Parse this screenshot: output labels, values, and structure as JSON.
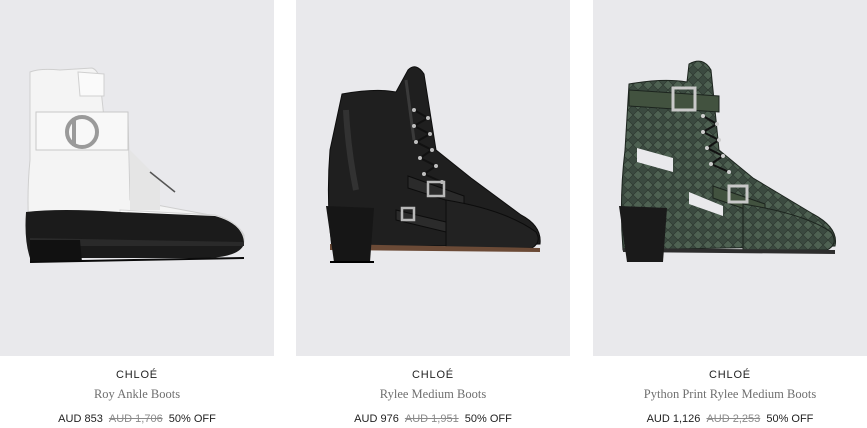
{
  "products": [
    {
      "brand": "CHLOÉ",
      "name": "Roy Ankle Boots",
      "price": "AUD 853",
      "original_price": "AUD 1,706",
      "discount": "50% OFF"
    },
    {
      "brand": "CHLOÉ",
      "name": "Rylee Medium Boots",
      "price": "AUD 976",
      "original_price": "AUD 1,951",
      "discount": "50% OFF"
    },
    {
      "brand": "CHLOÉ",
      "name": "Python Print Rylee Medium Boots",
      "price": "AUD 1,126",
      "original_price": "AUD 2,253",
      "discount": "50% OFF"
    }
  ],
  "colors": {
    "image_background": "#e9e9ec",
    "brand_text": "#222222",
    "name_text": "#6f6f6f",
    "strike_price": "#8a8a8a"
  }
}
